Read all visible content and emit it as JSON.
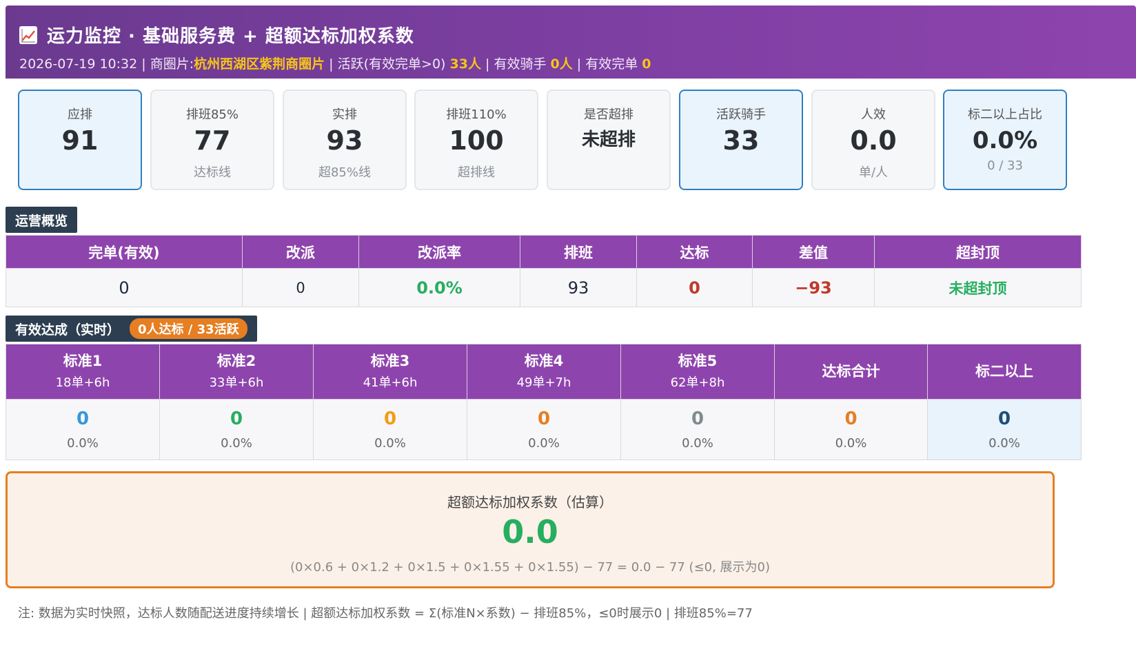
{
  "header": {
    "title": "运力监控 · 基础服务费 + 超额达标加权系数",
    "icon": "chart-increasing-icon",
    "datetime": "2026-07-19 10:32",
    "zone_label": "商圈片:",
    "zone_value": "杭州西湖区紫荆商圈片",
    "active_label": "活跃(有效完单>0)",
    "active_value": "33人",
    "valid_rider_label": "有效骑手",
    "valid_rider_value": "0人",
    "valid_order_label": "有效完单",
    "valid_order_value": "0"
  },
  "kpis": [
    {
      "label": "应排",
      "value": "91",
      "sub": ""
    },
    {
      "label": "排班85%",
      "value": "77",
      "sub": "达标线"
    },
    {
      "label": "实排",
      "value": "93",
      "sub": "超85%线"
    },
    {
      "label": "排班110%",
      "value": "100",
      "sub": "超排线"
    },
    {
      "label": "是否超排",
      "value": "未超排",
      "sub": ""
    },
    {
      "label": "活跃骑手",
      "value": "33",
      "sub": ""
    },
    {
      "label": "人效",
      "value": "0.0",
      "sub": "单/人"
    },
    {
      "label": "标二以上占比",
      "value": "0.0%",
      "sub": "0 / 33"
    }
  ],
  "ops": {
    "tag": "运营概览",
    "headers": [
      "完单(有效)",
      "改派",
      "改派率",
      "排班",
      "达标",
      "差值",
      "超封顶"
    ],
    "values": [
      "0",
      "0",
      "0.0%",
      "93",
      "0",
      "−93",
      "未超封顶"
    ]
  },
  "achv": {
    "tag": "有效达成（实时）",
    "pill": "0人达标 / 33活跃",
    "headers": [
      {
        "name": "标准1",
        "rule": "18单+6h"
      },
      {
        "name": "标准2",
        "rule": "33单+6h"
      },
      {
        "name": "标准3",
        "rule": "41单+6h"
      },
      {
        "name": "标准4",
        "rule": "49单+7h"
      },
      {
        "name": "标准5",
        "rule": "62单+8h"
      },
      {
        "name": "达标合计",
        "rule": ""
      },
      {
        "name": "标二以上",
        "rule": ""
      }
    ],
    "cells": [
      {
        "n": "0",
        "p": "0.0%"
      },
      {
        "n": "0",
        "p": "0.0%"
      },
      {
        "n": "0",
        "p": "0.0%"
      },
      {
        "n": "0",
        "p": "0.0%"
      },
      {
        "n": "0",
        "p": "0.0%"
      },
      {
        "n": "0",
        "p": "0.0%"
      },
      {
        "n": "0",
        "p": "0.0%"
      }
    ]
  },
  "coef": {
    "title": "超额达标加权系数（估算）",
    "value": "0.0",
    "formula": "(0×0.6 + 0×1.2 + 0×1.5 + 0×1.55 + 0×1.55) − 77 = 0.0 − 77 (≤0, 展示为0)"
  },
  "note": "注: 数据为实时快照，达标人数随配送进度持续增长 | 超额达标加权系数 = Σ(标准N×系数) − 排班85%，≤0时展示0 | 排班85%=77",
  "colors": {
    "header_start": "#6b3a8f",
    "header_end": "#8e44ad",
    "table_header": "#8e44ad",
    "highlight": "#f5c518",
    "green": "#27ae60",
    "red": "#c0392b",
    "orange": "#e67e22",
    "card_border_active": "#2f7fc1"
  }
}
